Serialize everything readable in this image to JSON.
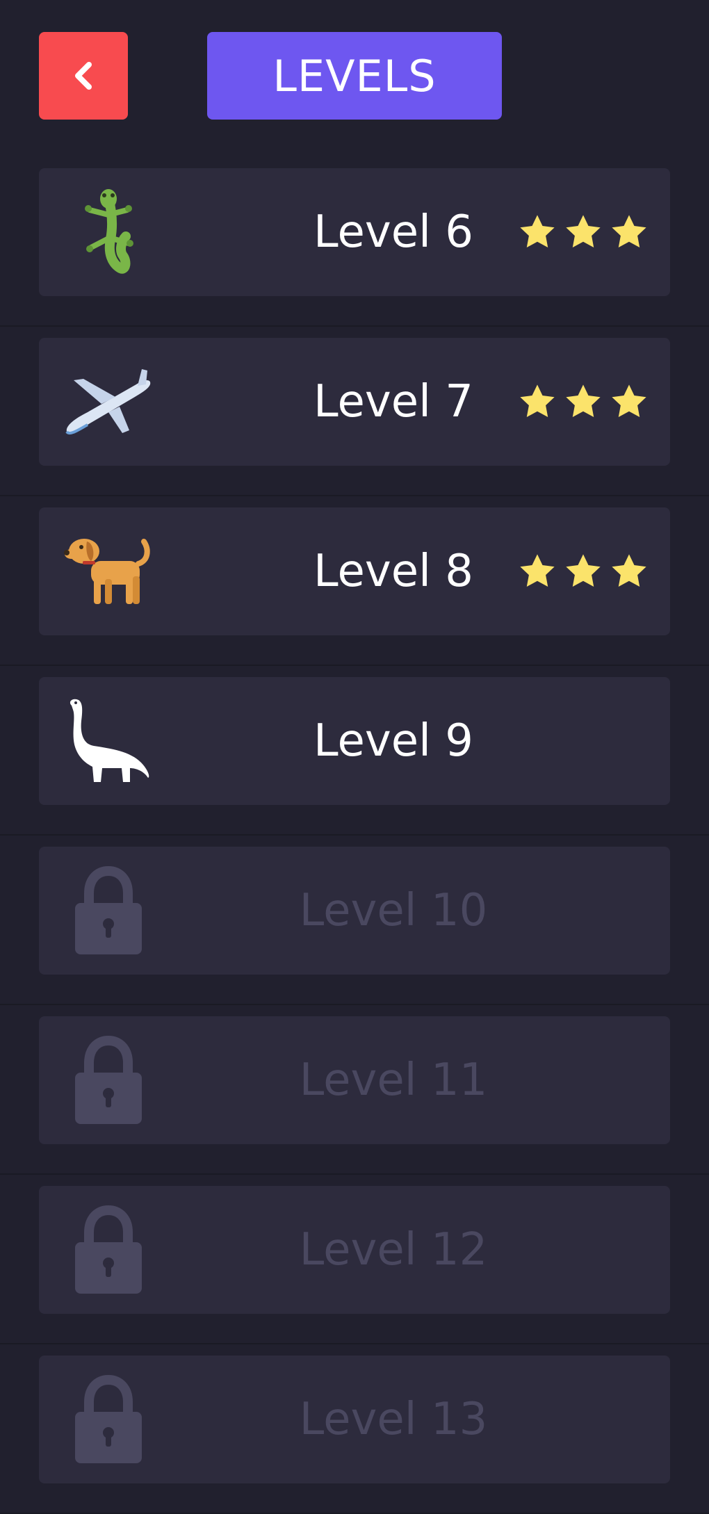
{
  "header": {
    "back_label": "<",
    "title": "LEVELS"
  },
  "colors": {
    "background": "#21202e",
    "card": "#2d2b3d",
    "back_button": "#f84b4f",
    "title_box": "#6e57f0",
    "star": "#fbe36b",
    "locked_text": "#4a4860"
  },
  "levels": [
    {
      "label": "Level 6",
      "icon": "lizard-icon",
      "stars": 3,
      "locked": false
    },
    {
      "label": "Level 7",
      "icon": "airplane-icon",
      "stars": 3,
      "locked": false
    },
    {
      "label": "Level 8",
      "icon": "dog-icon",
      "stars": 3,
      "locked": false
    },
    {
      "label": "Level 9",
      "icon": "dinosaur-icon",
      "stars": 0,
      "locked": false
    },
    {
      "label": "Level 10",
      "icon": "lock-icon",
      "stars": 0,
      "locked": true
    },
    {
      "label": "Level 11",
      "icon": "lock-icon",
      "stars": 0,
      "locked": true
    },
    {
      "label": "Level 12",
      "icon": "lock-icon",
      "stars": 0,
      "locked": true
    },
    {
      "label": "Level 13",
      "icon": "lock-icon",
      "stars": 0,
      "locked": true
    }
  ]
}
